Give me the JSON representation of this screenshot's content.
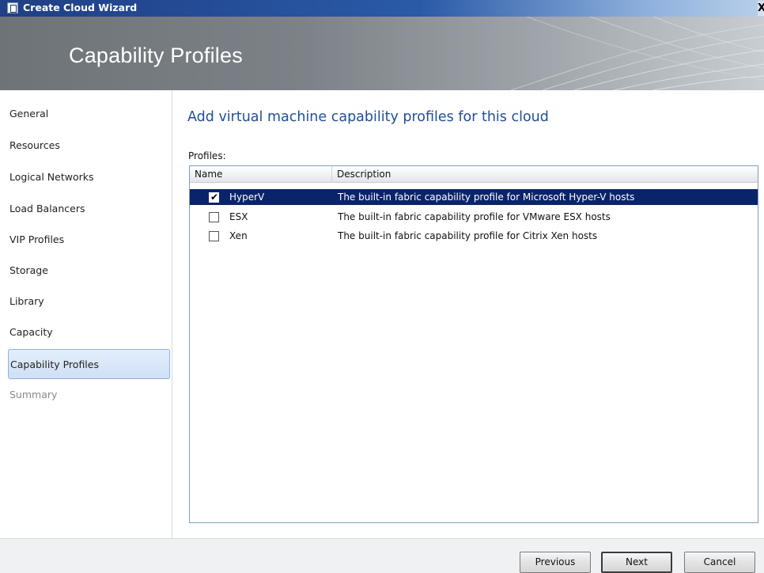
{
  "window": {
    "title": "Create Cloud Wizard",
    "close_glyph": "X"
  },
  "banner": {
    "title": "Capability Profiles"
  },
  "nav": {
    "items": [
      {
        "label": "General",
        "state": "normal"
      },
      {
        "label": "Resources",
        "state": "normal"
      },
      {
        "label": "Logical Networks",
        "state": "normal"
      },
      {
        "label": "Load Balancers",
        "state": "normal"
      },
      {
        "label": "VIP Profiles",
        "state": "normal"
      },
      {
        "label": "Storage",
        "state": "normal"
      },
      {
        "label": "Library",
        "state": "normal"
      },
      {
        "label": "Capacity",
        "state": "normal"
      },
      {
        "label": "Capability Profiles",
        "state": "active"
      },
      {
        "label": "Summary",
        "state": "disabled"
      }
    ]
  },
  "main": {
    "heading": "Add virtual machine capability profiles for this cloud",
    "profiles_label": "Profiles:",
    "columns": {
      "name": "Name",
      "description": "Description"
    },
    "rows": [
      {
        "checked": true,
        "name": "HyperV",
        "description": "The built-in fabric capability profile for Microsoft Hyper-V hosts",
        "selected": true
      },
      {
        "checked": false,
        "name": "ESX",
        "description": "The built-in fabric capability profile for VMware ESX hosts",
        "selected": false
      },
      {
        "checked": false,
        "name": "Xen",
        "description": "The built-in fabric capability profile for Citrix Xen hosts",
        "selected": false
      }
    ]
  },
  "footer": {
    "previous": "Previous",
    "next": "Next",
    "cancel": "Cancel"
  },
  "icons": {
    "app": "wizard-window-icon",
    "check": "checkmark-icon"
  },
  "colors": {
    "heading": "#1f4e9b",
    "selection": "#0a246a",
    "titlebar": "#1f3f86"
  }
}
